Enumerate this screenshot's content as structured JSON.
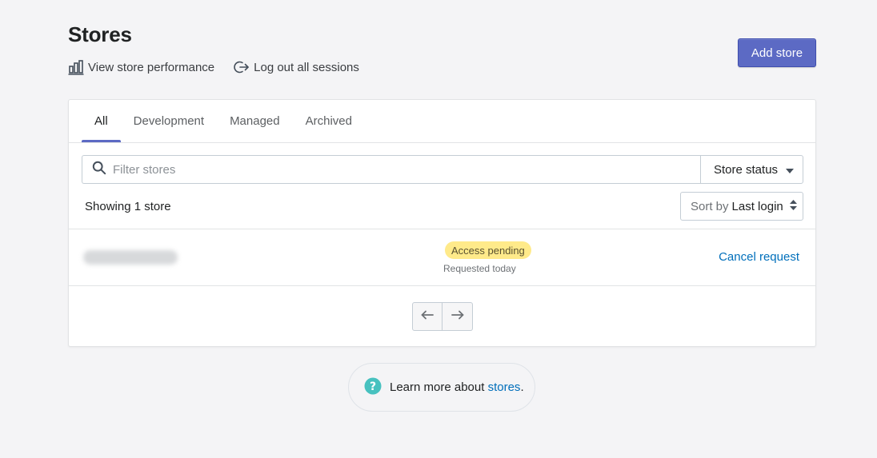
{
  "header": {
    "title": "Stores",
    "add_store_label": "Add store",
    "actions": {
      "view_performance": "View store performance",
      "logout_sessions": "Log out all sessions"
    }
  },
  "tabs": [
    {
      "label": "All",
      "active": true
    },
    {
      "label": "Development",
      "active": false
    },
    {
      "label": "Managed",
      "active": false
    },
    {
      "label": "Archived",
      "active": false
    }
  ],
  "filter": {
    "placeholder": "Filter stores",
    "value": "",
    "status_label": "Store status"
  },
  "list": {
    "showing_text": "Showing 1 store",
    "sort_label": "Sort by",
    "sort_value": "Last login",
    "rows": [
      {
        "badge": "Access pending",
        "requested": "Requested today",
        "action": "Cancel request"
      }
    ]
  },
  "footer": {
    "learn_prefix": "Learn more about ",
    "learn_link": "stores",
    "learn_suffix": "."
  },
  "colors": {
    "primary": "#5c6ac4",
    "link": "#006fbb",
    "badge_attention": "#ffea8a",
    "help_icon": "#47c1bf"
  },
  "icons": {
    "view_performance": "bar-chart-icon",
    "logout": "logout-arrow-icon",
    "search": "search-icon",
    "dropdown": "caret-down-icon",
    "sort": "sort-arrows-icon",
    "prev": "arrow-left-icon",
    "next": "arrow-right-icon",
    "help": "question-circle-icon"
  }
}
